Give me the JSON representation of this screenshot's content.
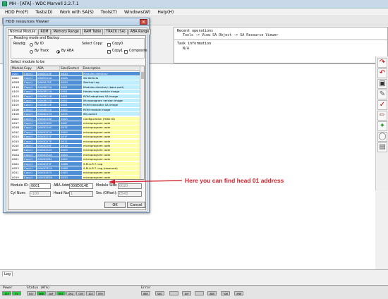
{
  "window": {
    "title": "MH - [ATA] - WDC Marvell 2.2.7.1"
  },
  "menu": [
    "HDD Pro(F)",
    "Tests(D)",
    "Work with SA(S)",
    "Tools(T)",
    "Windows(W)",
    "Help(H)"
  ],
  "info": {
    "recent_label": "Recent operations",
    "recent_value": "Tools -> View SA Object -> SA Resource Viewer",
    "task_label": "Task information",
    "task_value": "N/A"
  },
  "dialog": {
    "title": "HDD resources Viewer",
    "tabs": [
      "Normal Module",
      "ROM",
      "Memory Range",
      "RAM Table",
      "TRACK (SA)",
      "ABA Range"
    ],
    "readmode_legend": "Reading mode and Backup",
    "readwith_label": "Readig:",
    "by_id": "By ID",
    "by_track": "By Track",
    "by_aba": "By ABA",
    "select_copy_label": "Select Copy:",
    "copy0": "Copy0",
    "copy1": "Copy1",
    "composite": "Composite",
    "select_module_label": "Select module to be",
    "columns": [
      "Module ...",
      "Copy",
      "ABA",
      "Size(Sector)",
      "Description"
    ],
    "rows": [
      [
        "0001",
        "Copy1",
        "000D014E",
        "0020",
        "Modules directory",
        "hl"
      ],
      [
        "0002",
        "Copy1",
        "000D014A",
        "000A",
        "SA Defects",
        "cy"
      ],
      [
        "002D",
        "Copy1",
        "0000A75E",
        "0020",
        "Startup Log",
        "cy"
      ],
      [
        "0110",
        "Copy1",
        "0000BC2A",
        "0001",
        "Modules directory (base part)",
        "cy"
      ],
      [
        "0105",
        "Copy1",
        "0000BC4A",
        "0001",
        "Heads map module image",
        "cy"
      ],
      [
        "0103",
        "Copy1",
        "0000BC4B",
        "0001",
        "ROM adaptives SA image",
        "cy"
      ],
      [
        "0104",
        "Copy1",
        "0000BC4D",
        "0001",
        "Microprogram version image",
        "cy"
      ],
      [
        "0105",
        "Copy1",
        "0000BC4E",
        "0001",
        "ROM translator SA image",
        "cy"
      ],
      [
        "0106",
        "Copy1",
        "0000BC50",
        "0002",
        "ROM module image",
        "cy"
      ],
      [
        "0108",
        "Copy1",
        "0000D123",
        "0025",
        "IBI packet",
        "cy"
      ],
      [
        "0002",
        "Copy1",
        "0000D160",
        "0005",
        "Configuration (HDD ID)",
        "ye"
      ],
      [
        "0017",
        "Copy1",
        "0000D162",
        "000F",
        "microprogram code",
        "ye"
      ],
      [
        "001B",
        "Copy1",
        "0000D1AC",
        "007E",
        "microprogram code",
        "ye"
      ],
      [
        "001C",
        "Copy1",
        "0000D22A",
        "0005",
        "microprogram code",
        "ye"
      ],
      [
        "0014",
        "Copy1",
        "0000D25F",
        "001F",
        "microprogram code",
        "ye"
      ],
      [
        "0015",
        "Copy1",
        "0000D27E",
        "0011",
        "microprogram code",
        "ye"
      ],
      [
        "001E",
        "Copy1",
        "0000D28F",
        "0016",
        "microprogram code",
        "ye"
      ],
      [
        "002F",
        "Copy1",
        "0000D2A5",
        "0005",
        "microprogram code",
        "ye"
      ],
      [
        "002A",
        "Copy1",
        "0000D2AA",
        "0004",
        "microprogram code",
        "ye"
      ],
      [
        "0021",
        "Copy1",
        "0000D2B4",
        "0002",
        "microprogram code",
        "ye"
      ],
      [
        "0022",
        "Copy1",
        "0000D33F",
        "008B",
        "S.M.A.R.T. Log",
        "ye"
      ],
      [
        "0023",
        "Copy1",
        "0000D3CA",
        "008B",
        "S.M.A.R.T. Log (reserved)",
        "ye"
      ],
      [
        "0011",
        "Copy1",
        "0000D455",
        "0483",
        "microprogram code",
        "ye"
      ],
      [
        "0019",
        "Copy1",
        "0000D8D8",
        "0020",
        "microprogram code",
        "ye"
      ]
    ],
    "module_id_label": "Module ID:",
    "module_id_value": "0001",
    "aba_addr_label": "ABA Addr:",
    "aba_addr_value": "000D014E",
    "module_size_label": "Module Size:",
    "module_size_value": "0020",
    "cyl_label": "Cyl Num:",
    "cyl_value": "-100",
    "head_label": "Head Num:",
    "head_value": "1",
    "sec_label": "Sec (Offset):",
    "sec_value": "0543",
    "ok": "OK",
    "cancel": "Cancel"
  },
  "callout": "Here you can find head 01 address",
  "log_tab": "Log",
  "status": {
    "power_label": "Power",
    "power_leds": [
      "12V",
      "5V"
    ],
    "status_label": "Status (ATA)",
    "status_leds": [
      "BSY",
      "DRD",
      "DWF",
      "DSC",
      "DRQ",
      "CRR",
      "IDX",
      "ERR"
    ],
    "error_label": "Error",
    "error_leds": [
      "BBK",
      "UNC",
      "",
      "INF",
      "",
      "ABR",
      "TON",
      "AMN"
    ]
  },
  "colors": {
    "callout": "#d0202a",
    "led_on": "#2ecc40",
    "selected": "#4f8fd6",
    "cyan_row": "#bfefff",
    "yellow_row": "#ffffa8"
  }
}
